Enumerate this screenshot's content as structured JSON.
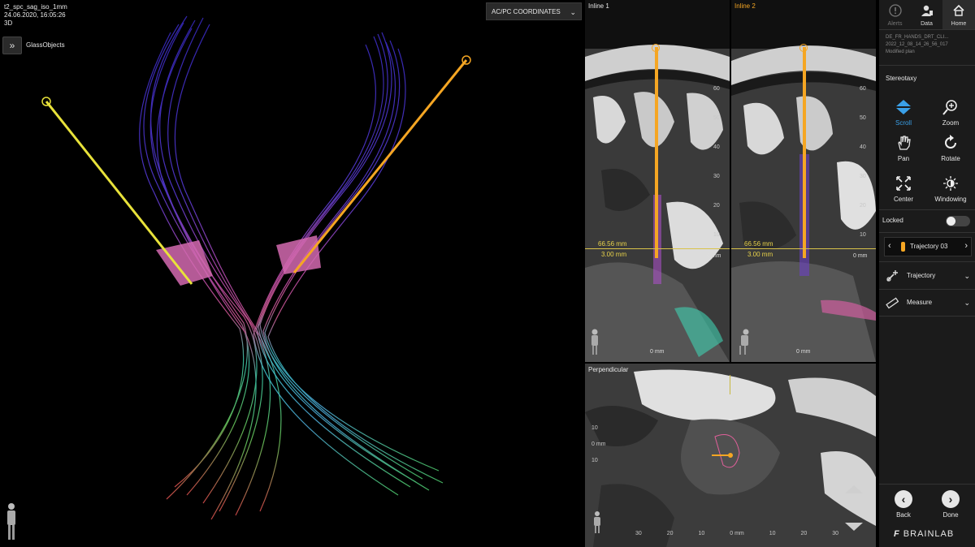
{
  "viewport_3d": {
    "series_name": "t2_spc_sag_iso_1mm",
    "datetime": "24.06.2020, 16:05:26",
    "mode": "3D",
    "glass_objects_label": "GlassObjects",
    "coord_dropdown": "AC/PC COORDINATES"
  },
  "inline1": {
    "title": "Inline 1",
    "measure_a": "66.56 mm",
    "measure_b": "3.00 mm",
    "zero_label": "0 mm",
    "bottom_label": "0 mm",
    "scale": [
      "60",
      "50",
      "40",
      "30",
      "20",
      "10"
    ]
  },
  "inline2": {
    "title": "Inline 2",
    "measure_a": "66.56 mm",
    "measure_b": "3.00 mm",
    "zero_label": "0 mm",
    "bottom_label": "0 mm",
    "scale": [
      "60",
      "50",
      "40",
      "30",
      "20",
      "10"
    ]
  },
  "perpendicular": {
    "title": "Perpendicular",
    "left_scale": [
      "10",
      "0 mm",
      "10"
    ],
    "bottom_scale": [
      "30",
      "20",
      "10",
      "0 mm",
      "10",
      "20",
      "30"
    ]
  },
  "sidebar": {
    "top_buttons": [
      {
        "label": "Alerts"
      },
      {
        "label": "Data"
      },
      {
        "label": "Home"
      }
    ],
    "patient_lines": [
      "DE_FR_HANDS_DRT_CLI...",
      "2022_12_08_14_26_56_017",
      "Modified plan"
    ],
    "section_title": "Stereotaxy",
    "tools": [
      {
        "label": "Scroll",
        "icon": "scroll-icon"
      },
      {
        "label": "Zoom",
        "icon": "zoom-icon"
      },
      {
        "label": "Pan",
        "icon": "pan-icon"
      },
      {
        "label": "Rotate",
        "icon": "rotate-icon"
      },
      {
        "label": "Center",
        "icon": "center-icon"
      },
      {
        "label": "Windowing",
        "icon": "windowing-icon"
      }
    ],
    "locked_label": "Locked",
    "trajectory_selector": "Trajectory 03",
    "trajectory_label": "Trajectory",
    "measure_label": "Measure",
    "back_label": "Back",
    "done_label": "Done",
    "brand": "BRAINLAB"
  },
  "colors": {
    "accent_blue": "#3aa0e8",
    "trajectory_orange": "#f5a623",
    "trajectory_yellow": "#e8e23a",
    "measure_yellow": "#d9c24a"
  }
}
